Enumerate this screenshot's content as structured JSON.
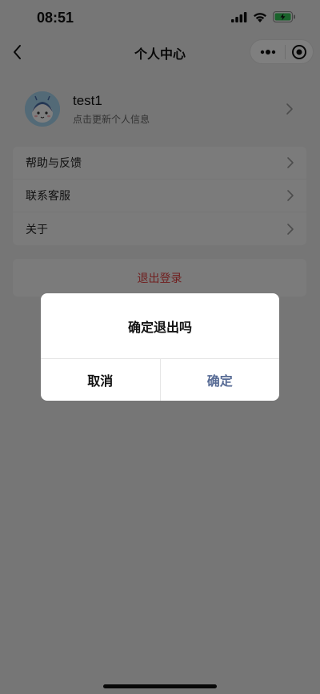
{
  "status_bar": {
    "time": "08:51"
  },
  "nav": {
    "title": "个人中心"
  },
  "profile": {
    "name": "test1",
    "subtitle": "点击更新个人信息"
  },
  "menu": {
    "items": [
      {
        "label": "帮助与反馈"
      },
      {
        "label": "联系客服"
      },
      {
        "label": "关于"
      }
    ]
  },
  "logout": {
    "label": "退出登录"
  },
  "dialog": {
    "title": "确定退出吗",
    "cancel_label": "取消",
    "confirm_label": "确定"
  },
  "colors": {
    "logout_text": "#e03f3f",
    "confirm_text": "#576b95",
    "mask": "rgba(0,0,0,0.5)"
  }
}
